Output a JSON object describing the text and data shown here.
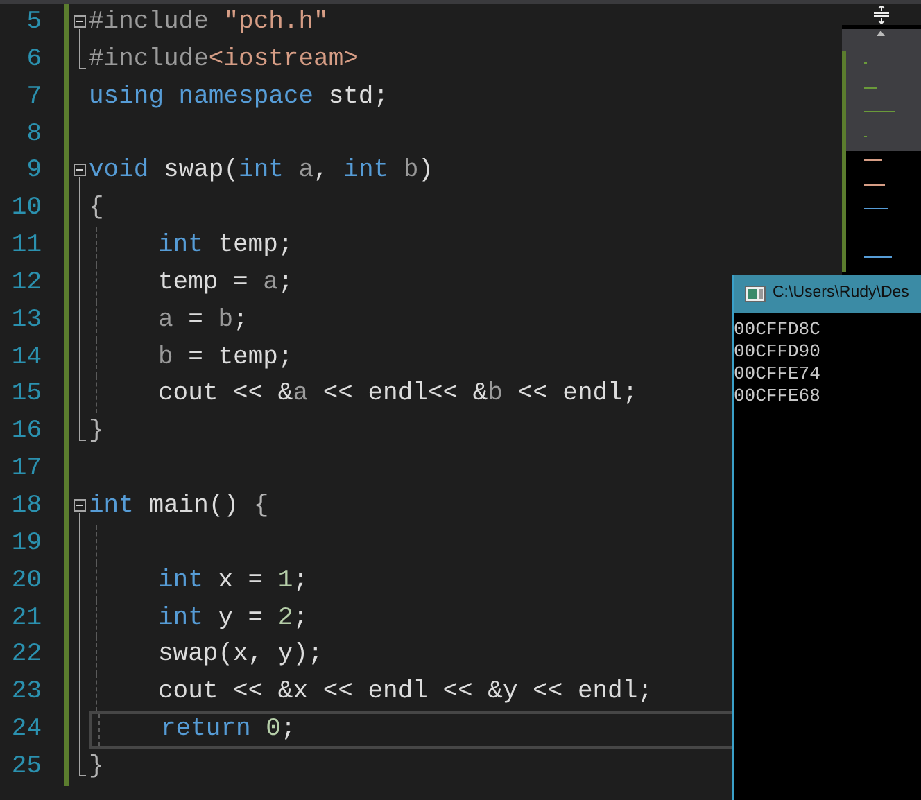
{
  "editor": {
    "lines": [
      {
        "number": "5",
        "collapsible": true,
        "block_end": false,
        "indented": false,
        "current": false,
        "tokens": [
          {
            "kind": "directive",
            "text": "#include"
          },
          {
            "kind": "string",
            "text": " \"pch.h\""
          }
        ]
      },
      {
        "number": "6",
        "collapsible": false,
        "block_end": true,
        "indented": false,
        "current": false,
        "tokens": [
          {
            "kind": "directive",
            "text": "#include"
          },
          {
            "kind": "string",
            "text": "<iostream>"
          }
        ]
      },
      {
        "number": "7",
        "collapsible": false,
        "block_end": false,
        "indented": false,
        "current": false,
        "tokens": [
          {
            "kind": "keyword",
            "text": "using namespace"
          },
          {
            "kind": "text",
            "text": " std;"
          }
        ]
      },
      {
        "number": "8",
        "collapsible": false,
        "block_end": false,
        "indented": false,
        "current": false
      },
      {
        "number": "9",
        "collapsible": true,
        "block_end": false,
        "indented": false,
        "current": false,
        "tokens": [
          {
            "kind": "keyword",
            "text": "void"
          },
          {
            "kind": "text",
            "text": " swap("
          },
          {
            "kind": "keyword",
            "text": "int"
          },
          {
            "kind": "param",
            "text": " a"
          },
          {
            "kind": "text",
            "text": ", "
          },
          {
            "kind": "keyword",
            "text": "int"
          },
          {
            "kind": "param",
            "text": " b"
          },
          {
            "kind": "text",
            "text": ")"
          }
        ]
      },
      {
        "number": "10",
        "collapsible": false,
        "block_end": false,
        "indented": false,
        "current": false,
        "tokens": [
          {
            "kind": "brace",
            "text": "{"
          }
        ]
      },
      {
        "number": "11",
        "collapsible": false,
        "block_end": false,
        "indented": true,
        "current": false,
        "tokens": [
          {
            "kind": "keyword",
            "text": "int"
          },
          {
            "kind": "text",
            "text": " temp;"
          }
        ]
      },
      {
        "number": "12",
        "collapsible": false,
        "block_end": false,
        "indented": true,
        "current": false,
        "tokens": [
          {
            "kind": "text",
            "text": "temp = "
          },
          {
            "kind": "param",
            "text": "a"
          },
          {
            "kind": "text",
            "text": ";"
          }
        ]
      },
      {
        "number": "13",
        "collapsible": false,
        "block_end": false,
        "indented": true,
        "current": false,
        "tokens": [
          {
            "kind": "param",
            "text": "a"
          },
          {
            "kind": "text",
            "text": " = "
          },
          {
            "kind": "param",
            "text": "b"
          },
          {
            "kind": "text",
            "text": ";"
          }
        ]
      },
      {
        "number": "14",
        "collapsible": false,
        "block_end": false,
        "indented": true,
        "current": false,
        "tokens": [
          {
            "kind": "param",
            "text": "b"
          },
          {
            "kind": "text",
            "text": " = temp;"
          }
        ]
      },
      {
        "number": "15",
        "collapsible": false,
        "block_end": false,
        "indented": true,
        "current": false,
        "tokens": [
          {
            "kind": "text",
            "text": "cout << &"
          },
          {
            "kind": "param",
            "text": "a"
          },
          {
            "kind": "text",
            "text": " << endl<< &"
          },
          {
            "kind": "param",
            "text": "b"
          },
          {
            "kind": "text",
            "text": " << endl;"
          }
        ]
      },
      {
        "number": "16",
        "collapsible": false,
        "block_end": true,
        "indented": false,
        "current": false,
        "tokens": [
          {
            "kind": "brace",
            "text": "}"
          }
        ]
      },
      {
        "number": "17",
        "collapsible": false,
        "block_end": false,
        "indented": false,
        "current": false
      },
      {
        "number": "18",
        "collapsible": true,
        "block_end": false,
        "indented": false,
        "current": false,
        "tokens": [
          {
            "kind": "keyword",
            "text": "int"
          },
          {
            "kind": "text",
            "text": " main() "
          },
          {
            "kind": "brace",
            "text": "{"
          }
        ]
      },
      {
        "number": "19",
        "collapsible": false,
        "block_end": false,
        "indented": true,
        "current": false
      },
      {
        "number": "20",
        "collapsible": false,
        "block_end": false,
        "indented": true,
        "current": false,
        "tokens": [
          {
            "kind": "keyword",
            "text": "int"
          },
          {
            "kind": "text",
            "text": " x = "
          },
          {
            "kind": "number",
            "text": "1"
          },
          {
            "kind": "text",
            "text": ";"
          }
        ]
      },
      {
        "number": "21",
        "collapsible": false,
        "block_end": false,
        "indented": true,
        "current": false,
        "tokens": [
          {
            "kind": "keyword",
            "text": "int"
          },
          {
            "kind": "text",
            "text": " y = "
          },
          {
            "kind": "number",
            "text": "2"
          },
          {
            "kind": "text",
            "text": ";"
          }
        ]
      },
      {
        "number": "22",
        "collapsible": false,
        "block_end": false,
        "indented": true,
        "current": false,
        "tokens": [
          {
            "kind": "text",
            "text": "swap(x, y);"
          }
        ]
      },
      {
        "number": "23",
        "collapsible": false,
        "block_end": false,
        "indented": true,
        "current": false,
        "tokens": [
          {
            "kind": "text",
            "text": "cout << &x << endl << &y << endl;"
          }
        ]
      },
      {
        "number": "24",
        "collapsible": false,
        "block_end": false,
        "indented": true,
        "current": true,
        "tokens": [
          {
            "kind": "keyword",
            "text": "return"
          },
          {
            "kind": "number",
            "text": " 0"
          },
          {
            "kind": "text",
            "text": ";"
          }
        ]
      },
      {
        "number": "25",
        "collapsible": false,
        "block_end": true,
        "indented": false,
        "current": false,
        "tokens": [
          {
            "kind": "brace",
            "text": "}"
          }
        ]
      }
    ]
  },
  "console": {
    "title": "C:\\Users\\Rudy\\Des",
    "output": [
      "00CFFD8C",
      "00CFFD90",
      "00CFFE74",
      "00CFFE68"
    ]
  }
}
